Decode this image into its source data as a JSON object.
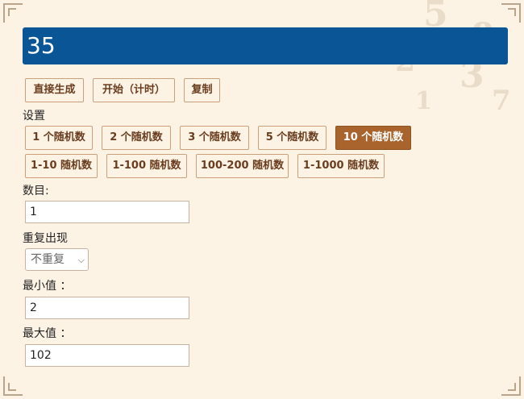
{
  "result": {
    "value": "35"
  },
  "actions": {
    "generate": "直接生成",
    "start_timed": "开始（计时）",
    "copy": "复制"
  },
  "settings": {
    "title": "设置",
    "presets_count": [
      "1 个随机数",
      "2 个随机数",
      "3 个随机数",
      "5 个随机数",
      "10 个随机数"
    ],
    "active_count_preset": "10 个随机数",
    "presets_range": [
      "1-10 随机数",
      "1-100 随机数",
      "100-200 随机数",
      "1-1000 随机数"
    ]
  },
  "form": {
    "count_label": "数目:",
    "count_value": "1",
    "repeat_label": "重复出现",
    "repeat_selected": "不重复",
    "min_label": "最小值 ：",
    "min_value": "2",
    "max_label": "最大值 ：",
    "max_value": "102"
  },
  "colors": {
    "page_background": "#fdf3e5",
    "result_background": "#0a5596",
    "active_button": "#a8642c",
    "button_text": "#6a3d1e"
  },
  "icons": {
    "select_arrow": "chevron-down-icon"
  }
}
